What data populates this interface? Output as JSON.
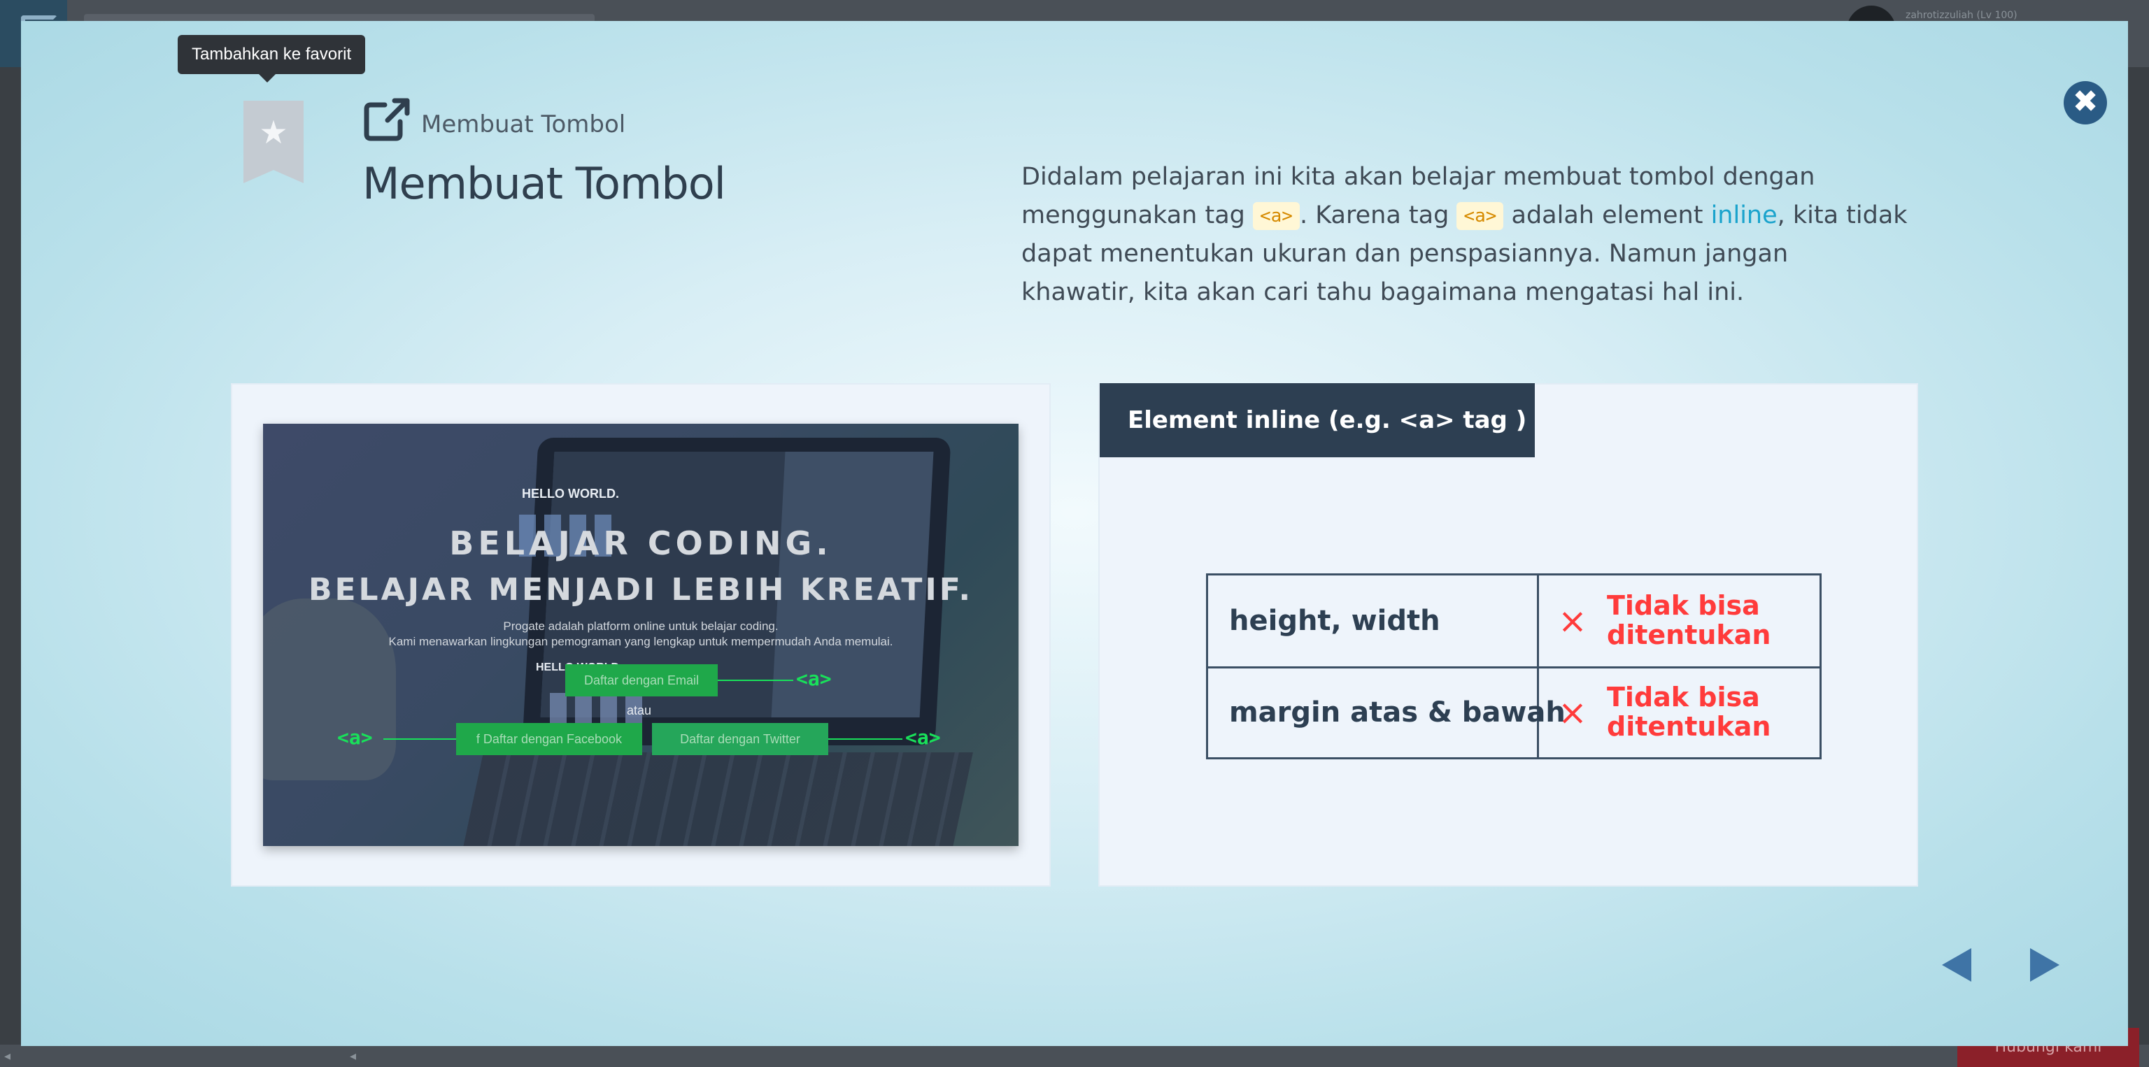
{
  "background": {
    "user_label": "zahrotizzuliah (Lv 100)",
    "chat_button": "Hubungi kami"
  },
  "tooltip": {
    "text": "Tambahkan ke favorit"
  },
  "header": {
    "subtitle": "Membuat Tombol",
    "title": "Membuat Tombol"
  },
  "description": {
    "part1": "Didalam pelajaran ini kita akan belajar membuat tombol dengan menggunakan tag ",
    "code1": "<a>",
    "part2": ". Karena tag ",
    "code2": "<a>",
    "part3": " adalah element ",
    "link": "inline",
    "part4": ", kita tidak dapat menentukan ukuran dan penspasiannya. Namun jangan khawatir, kita akan cari tahu bagaimana mengatasi hal ini."
  },
  "left_card": {
    "heading1": "BELAJAR CODING.",
    "heading2": "BELAJAR MENJADI LEBIH KREATIF.",
    "line1": "Progate adalah platform online untuk belajar coding.",
    "line2": "Kami menawarkan lingkungan pemograman yang lengkap untuk mempermudah Anda memulai.",
    "btn_email": "Daftar dengan Email",
    "atau": "atau",
    "btn_facebook": "f  Daftar dengan Facebook",
    "btn_twitter": "Daftar dengan Twitter",
    "a_tag_label": "<a>",
    "hello": "HELLO WORLD.",
    "hello2": "HELLO WORLD."
  },
  "right_card": {
    "header": "Element inline (e.g. <a> tag )",
    "rows": [
      {
        "property": "height, width",
        "status": "Tidak bisa ditentukan"
      },
      {
        "property": "margin atas & bawah",
        "status": "Tidak bisa ditentukan"
      }
    ],
    "x_symbol": "×"
  },
  "icons": {
    "bookmark": "bookmark-star-icon",
    "external": "external-link-icon",
    "close": "close-icon",
    "prev": "prev-arrow-icon",
    "next": "next-arrow-icon"
  },
  "colors": {
    "accent_navy": "#2d3f52",
    "link": "#1aa3cc",
    "code_bg": "#fff7d6",
    "code_fg": "#d68a00",
    "negative": "#ff3b3b",
    "close_bg": "#2a5b85",
    "nav_arrow": "#3f74a6",
    "green_tag": "#19e05a"
  }
}
